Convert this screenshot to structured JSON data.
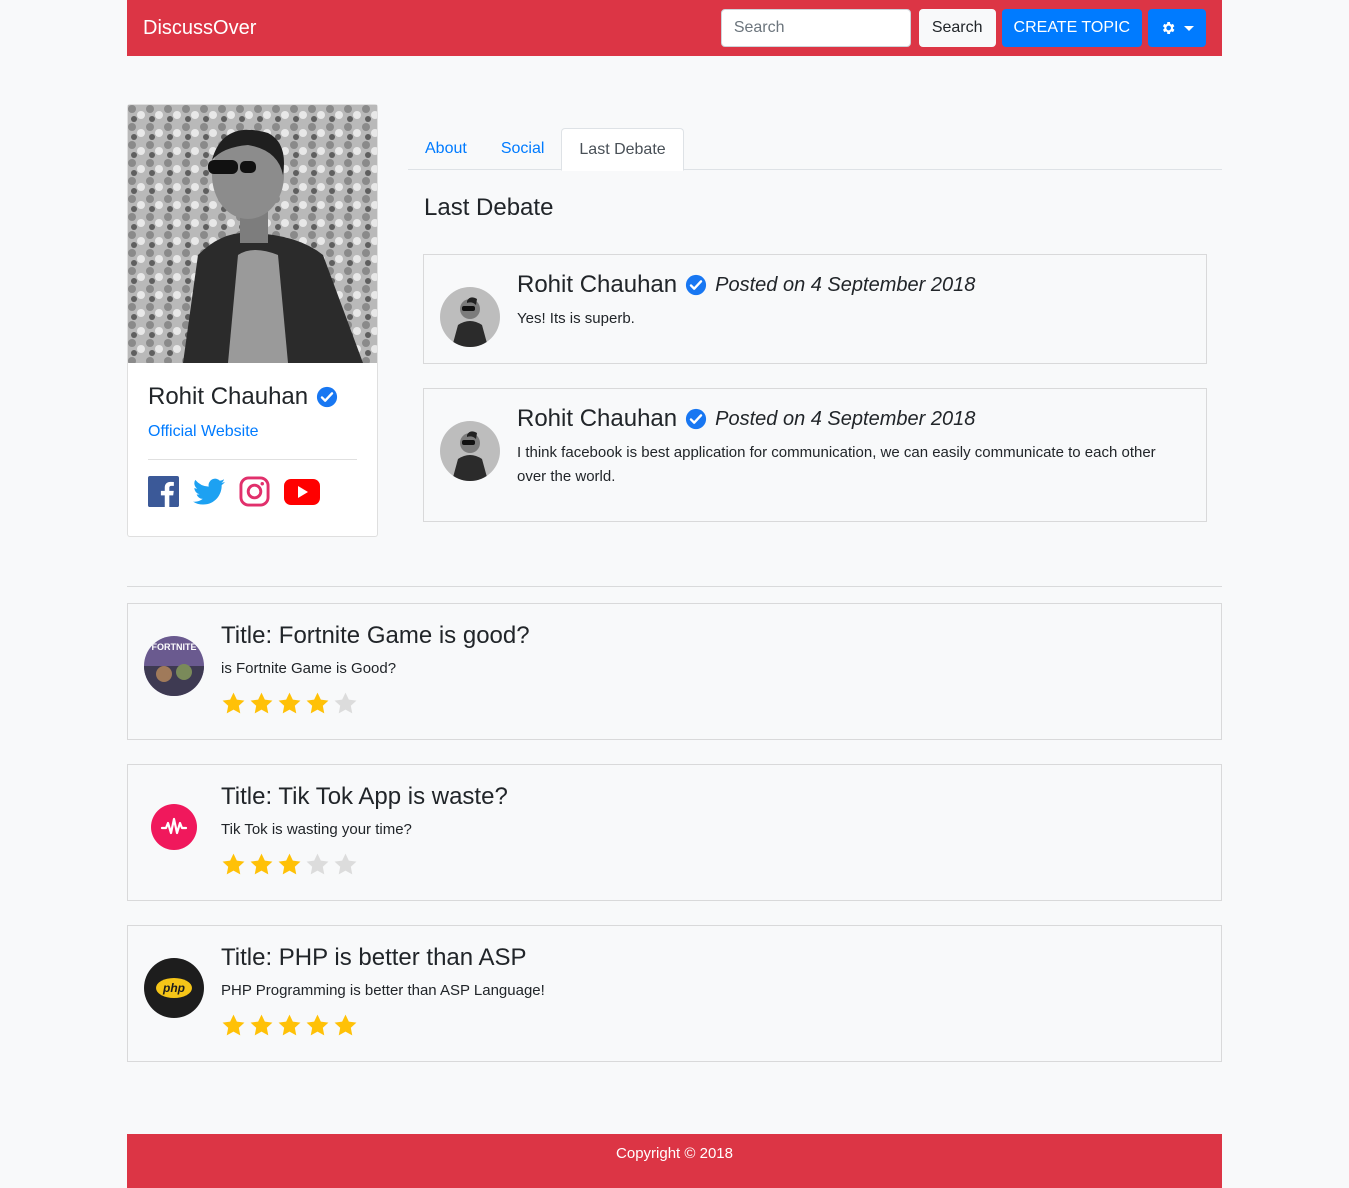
{
  "navbar": {
    "brand": "DiscussOver",
    "search_placeholder": "Search",
    "search_button": "Search",
    "create_button": "CREATE TOPIC",
    "settings_icon": "gear-icon"
  },
  "profile": {
    "name": "Rohit Chauhan",
    "website_label": "Official Website",
    "socials": [
      "facebook-icon",
      "twitter-icon",
      "instagram-icon",
      "youtube-icon"
    ]
  },
  "tabs": [
    {
      "label": "About"
    },
    {
      "label": "Social"
    },
    {
      "label": "Last Debate",
      "active": true
    }
  ],
  "section_title": "Last Debate",
  "debates": [
    {
      "author": "Rohit Chauhan",
      "posted": "Posted on 4 September 2018",
      "text": "Yes! Its is superb."
    },
    {
      "author": "Rohit Chauhan",
      "posted": "Posted on 4 September 2018",
      "text": "I think facebook is best application for communication, we can easily communicate to each other over the world."
    }
  ],
  "topics": [
    {
      "title": "Title: Fortnite Game is good?",
      "desc": "is Fortnite Game is Good?",
      "rating": 4,
      "max_rating": 5
    },
    {
      "title": "Title: Tik Tok App is waste?",
      "desc": "Tik Tok is wasting your time?",
      "rating": 3,
      "max_rating": 5
    },
    {
      "title": "Title: PHP is better than ASP",
      "desc": "PHP Programming is better than ASP Language!",
      "rating": 5,
      "max_rating": 5
    }
  ],
  "topic_logo_texts": [
    "FORTNITE",
    "php"
  ],
  "footer": {
    "copyright": "Copyright © 2018"
  },
  "colors": {
    "brand": "#dc3545",
    "primary": "#007bff",
    "star_on": "#ffc107",
    "star_off": "#dcdcdc",
    "verified": "#1877f2"
  }
}
